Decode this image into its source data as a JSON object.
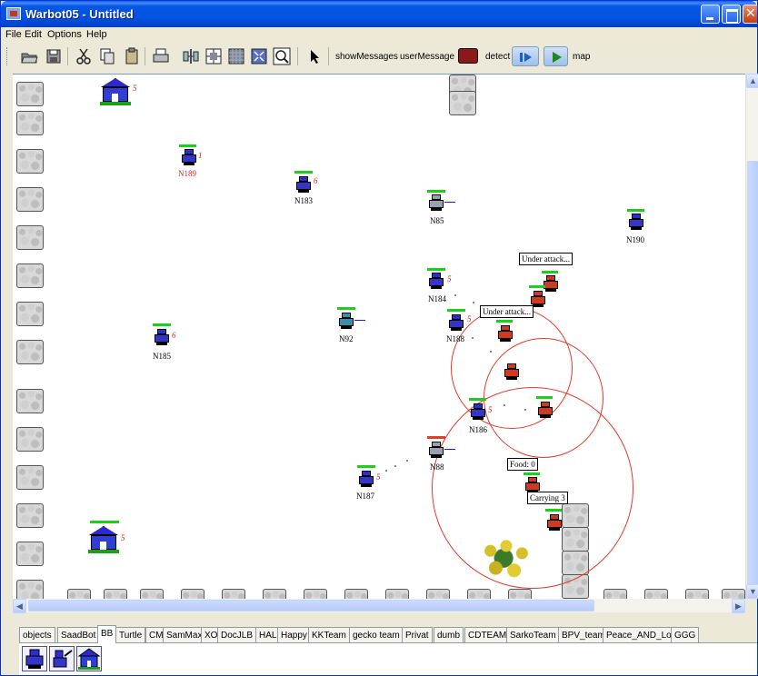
{
  "window": {
    "title": "Warbot05 - Untitled",
    "controls": [
      "minimize",
      "maximize",
      "close"
    ]
  },
  "menubar": {
    "items": [
      "File",
      "Edit",
      "Options",
      "Help"
    ]
  },
  "toolbar": {
    "icons": [
      "open-folder-icon",
      "save-icon",
      "cut-icon",
      "copy-icon",
      "paste-icon",
      "print-icon",
      "align-icon",
      "grid-icon",
      "grid-fill-icon",
      "fit-icon",
      "zoom-icon",
      "pointer-icon"
    ],
    "show_messages_label": "showMessages",
    "user_message_label": "userMessage",
    "detect_label": "detect",
    "map_label": "map",
    "stop_color": "#8B1919"
  },
  "simulation": {
    "agents": [
      {
        "label": "N189",
        "team": "blue",
        "energy_label": "1"
      },
      {
        "label": "N183",
        "team": "blue",
        "energy_label": "6"
      },
      {
        "label": "N85",
        "team": "blue",
        "energy_label": ""
      },
      {
        "label": "N190",
        "team": "blue",
        "energy_label": ""
      },
      {
        "label": "N184",
        "team": "blue",
        "energy_label": "5"
      },
      {
        "label": "N92",
        "team": "blue",
        "energy_label": ""
      },
      {
        "label": "N188",
        "team": "blue",
        "energy_label": "5"
      },
      {
        "label": "N185",
        "team": "blue",
        "energy_label": "6"
      },
      {
        "label": "N186",
        "team": "blue",
        "energy_label": "5"
      },
      {
        "label": "N88",
        "team": "blue",
        "energy_label": ""
      },
      {
        "label": "N187",
        "team": "blue",
        "energy_label": "5"
      }
    ],
    "bases": [
      {
        "energy_label": "5"
      },
      {
        "energy_label": "5"
      }
    ],
    "messages": [
      "Under attack...",
      "Under attack...",
      "Food: 0",
      "Carrying 3"
    ],
    "team_colors": {
      "blue": "#2c2cd8",
      "red": "#d23a20"
    }
  },
  "tabs": {
    "items": [
      "objects",
      "SaadBot",
      "BB",
      "Turtle",
      "CM",
      "SamMax",
      "XO",
      "DocJLB",
      "HAL",
      "Happy",
      "KKTeam",
      "gecko team",
      "Privat",
      "dumb",
      "CDTEAM",
      "SarkoTeam",
      "BPV_team",
      "Peace_AND_Love",
      "GGG"
    ],
    "active": "BB",
    "palette": [
      "rocket-launcher-icon",
      "explorer-icon",
      "base-icon"
    ]
  }
}
